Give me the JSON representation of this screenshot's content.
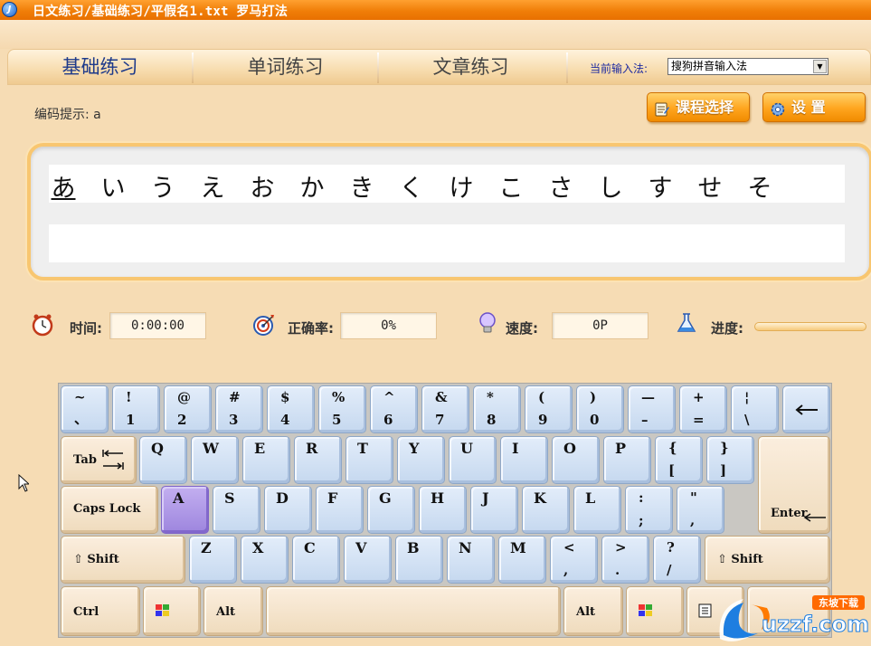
{
  "window": {
    "title": "日文练习/基础练习/平假名1.txt 罗马打法",
    "icon": "app-icon"
  },
  "tabs": [
    {
      "label": "基础练习",
      "active": true
    },
    {
      "label": "单词练习",
      "active": false
    },
    {
      "label": "文章练习",
      "active": false
    }
  ],
  "ime": {
    "label": "当前输入法:",
    "value": "搜狗拼音输入法"
  },
  "hint": {
    "text": "编码提示: a"
  },
  "buttons": {
    "course": "课程选择",
    "settings": "设 置"
  },
  "practice": {
    "kana": [
      "あ",
      "い",
      "う",
      "え",
      "お",
      "か",
      "き",
      "く",
      "け",
      "こ",
      "さ",
      "し",
      "す",
      "せ",
      "そ"
    ],
    "current_index": 0,
    "input": ""
  },
  "stats": {
    "time_label": "时间:",
    "time_value": "0:00:00",
    "accuracy_label": "正确率:",
    "accuracy_value": "0%",
    "speed_label": "速度:",
    "speed_value": "0P",
    "progress_label": "进度:",
    "progress_value": 0
  },
  "keyboard": {
    "row1": [
      [
        "~",
        "、"
      ],
      [
        "!",
        "1"
      ],
      [
        "@",
        "2"
      ],
      [
        "#",
        "3"
      ],
      [
        "$",
        "4"
      ],
      [
        "%",
        "5"
      ],
      [
        "^",
        "6"
      ],
      [
        "&",
        "7"
      ],
      [
        "*",
        "8"
      ],
      [
        "(",
        "9"
      ],
      [
        ")",
        "0"
      ],
      [
        "—",
        "–"
      ],
      [
        "+",
        "="
      ],
      [
        "¦",
        "\\"
      ]
    ],
    "tab": "Tab",
    "row2": [
      "Q",
      "W",
      "E",
      "R",
      "T",
      "Y",
      "U",
      "I",
      "O",
      "P"
    ],
    "row2_sym": [
      [
        "{",
        "["
      ],
      [
        "}",
        "]"
      ]
    ],
    "caps": "Caps Lock",
    "row3": [
      "A",
      "S",
      "D",
      "F",
      "G",
      "H",
      "J",
      "K",
      "L"
    ],
    "row3_sym": [
      [
        ":",
        ";"
      ],
      [
        "\"",
        ","
      ]
    ],
    "enter": "Enter",
    "shift": "Shift",
    "row4": [
      "Z",
      "X",
      "C",
      "V",
      "B",
      "N",
      "M"
    ],
    "row4_sym": [
      [
        "<",
        ","
      ],
      [
        ">",
        "."
      ],
      [
        "?",
        "/"
      ]
    ],
    "ctrl": "Ctrl",
    "alt": "Alt",
    "active_key": "A"
  },
  "watermark": {
    "main": "uzzf.com",
    "sub": "东坡下载"
  },
  "colors": {
    "titlebar": "#f07e08",
    "accent": "#ffa51e",
    "active_key": "#9d85de",
    "key": "#c5d8ef"
  }
}
